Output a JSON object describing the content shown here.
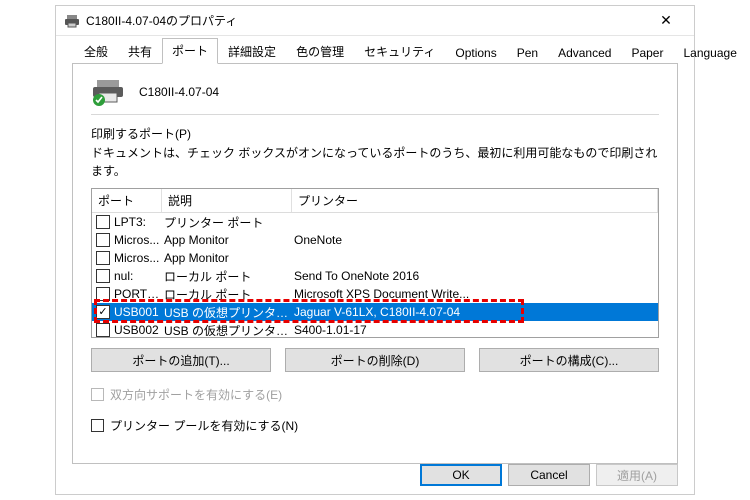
{
  "window": {
    "title": "C180II-4.07-04のプロパティ",
    "close_glyph": "✕"
  },
  "tabs": [
    {
      "label": "全般"
    },
    {
      "label": "共有"
    },
    {
      "label": "ポート"
    },
    {
      "label": "詳細設定"
    },
    {
      "label": "色の管理"
    },
    {
      "label": "セキュリティ"
    },
    {
      "label": "Options"
    },
    {
      "label": "Pen"
    },
    {
      "label": "Advanced"
    },
    {
      "label": "Paper"
    },
    {
      "label": "Language"
    }
  ],
  "active_tab_index": 2,
  "device_name": "C180II-4.07-04",
  "section": {
    "title": "印刷するポート(P)",
    "desc": "ドキュメントは、チェック ボックスがオンになっているポートのうち、最初に利用可能なもので印刷されます。"
  },
  "columns": {
    "port": "ポート",
    "desc": "説明",
    "printer": "プリンター"
  },
  "ports": [
    {
      "checked": false,
      "port": "LPT3:",
      "desc": "プリンター ポート",
      "printer": ""
    },
    {
      "checked": false,
      "port": "Micros...",
      "desc": "App Monitor",
      "printer": "OneNote"
    },
    {
      "checked": false,
      "port": "Micros...",
      "desc": "App Monitor",
      "printer": ""
    },
    {
      "checked": false,
      "port": "nul:",
      "desc": "ローカル ポート",
      "printer": "Send To OneNote 2016"
    },
    {
      "checked": false,
      "port": "PORTP...",
      "desc": "ローカル ポート",
      "printer": "Microsoft XPS Document Write..."
    },
    {
      "checked": true,
      "port": "USB001",
      "desc": "USB の仮想プリンター ポ...",
      "printer": "Jaguar V-61LX, C180II-4.07-04",
      "selected": true
    },
    {
      "checked": false,
      "port": "USB002",
      "desc": "USB の仮想プリンター ポ...",
      "printer": "S400-1.01-17"
    }
  ],
  "port_buttons": {
    "add": "ポートの追加(T)...",
    "del": "ポートの削除(D)",
    "cfg": "ポートの構成(C)..."
  },
  "options": {
    "bidir": "双方向サポートを有効にする(E)",
    "pool": "プリンター プールを有効にする(N)"
  },
  "footer": {
    "ok": "OK",
    "cancel": "Cancel",
    "apply": "適用(A)"
  }
}
